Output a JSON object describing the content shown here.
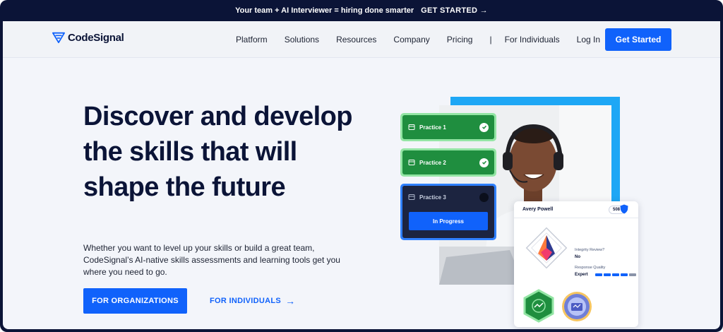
{
  "banner": {
    "text": "Your team + AI Interviewer = hiring done smarter",
    "cta": "GET STARTED →"
  },
  "nav": {
    "logo": "CodeSignal",
    "items": [
      {
        "label": "Platform"
      },
      {
        "label": "Solutions"
      },
      {
        "label": "Resources"
      },
      {
        "label": "Company"
      },
      {
        "label": "Pricing"
      }
    ],
    "separator": "|",
    "for_individuals": "For Individuals",
    "login": "Log In",
    "get_started": "Get Started"
  },
  "hero": {
    "title": "Discover and develop the skills that will shape the future",
    "subtitle": "Whether you want to level up your skills or build a great team, CodeSignal’s AI-native skills assessments and learning tools get you where you need to go.",
    "btn_org": "FOR ORGANIZATIONS",
    "link_individuals": "FOR INDIVIDUALS",
    "link_arrow": "→"
  },
  "practice": [
    {
      "label": "Practice 1",
      "status": "complete"
    },
    {
      "label": "Practice 2",
      "status": "complete"
    },
    {
      "label": "Practice 3",
      "status": "in-progress",
      "button": "In Progress"
    }
  ],
  "profile": {
    "name": "Avery Powell",
    "score": "508",
    "integrity_label": "Integrity Review?",
    "integrity_value": "No",
    "quality_label": "Response Quality",
    "quality_value": "Expert",
    "quality_level": 4,
    "quality_max": 5
  },
  "colors": {
    "primary": "#1062fb",
    "navy": "#0b1437",
    "green": "#1f8e3f",
    "sky": "#1ea7f5"
  }
}
